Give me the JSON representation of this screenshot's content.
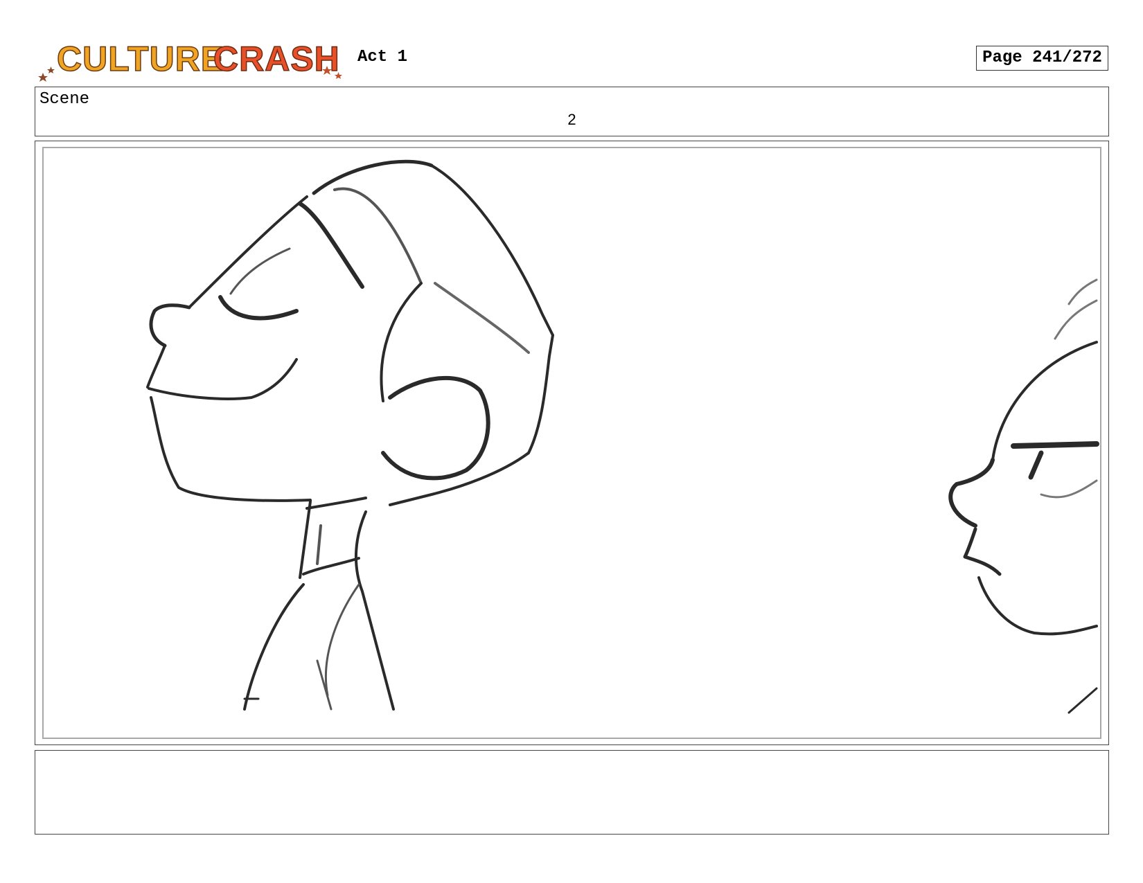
{
  "header": {
    "logo_text": "CULTURE CRASH",
    "act": "Act 1",
    "page": "Page 241/272"
  },
  "scene": {
    "label": "Scene",
    "number": "2"
  },
  "panel": {
    "content": "sketch"
  },
  "notes": {
    "text": ""
  }
}
